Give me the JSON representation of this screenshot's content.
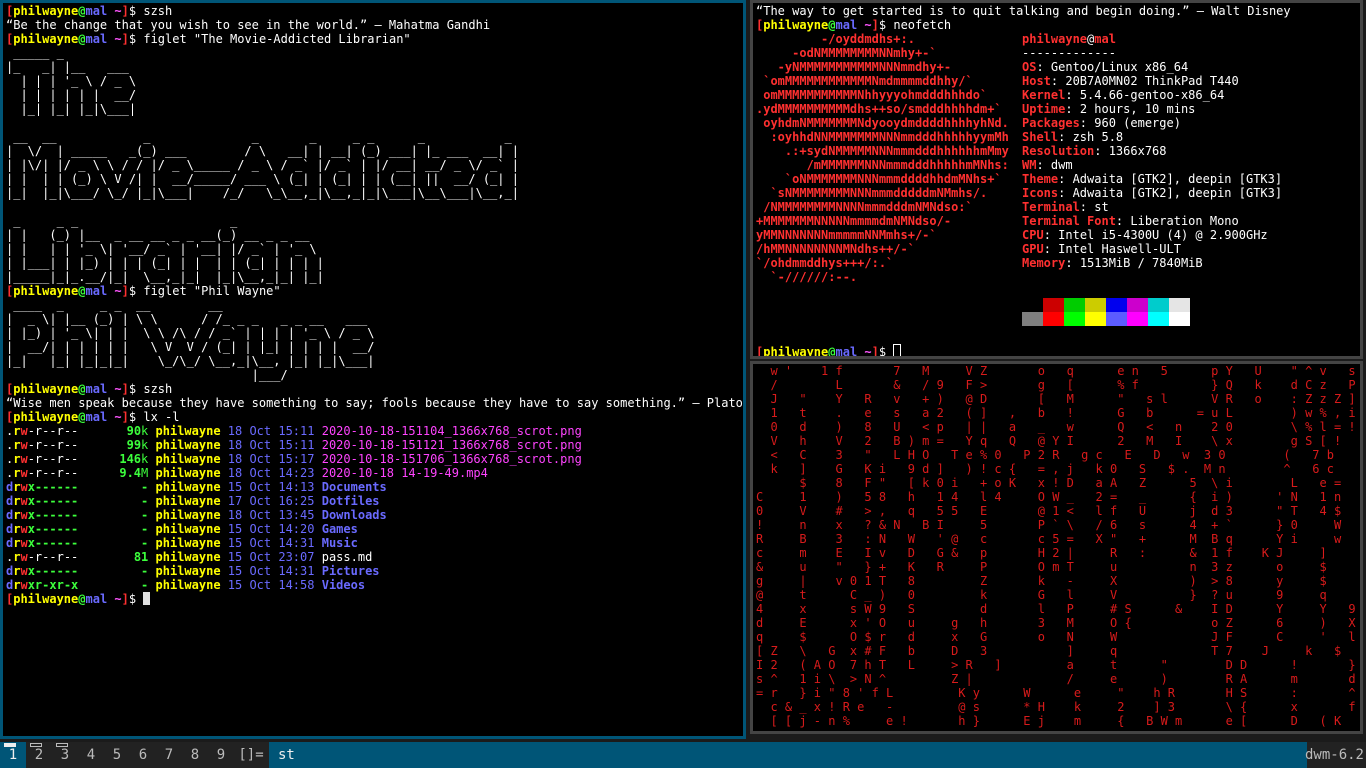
{
  "term1": {
    "prompt": {
      "user": "philwayne",
      "host": "mal",
      "dir": "~"
    },
    "cmd1": "szsh",
    "quote1": "“Be the change that you wish to see in the world.” — Mahatma Gandhi",
    "cmd2": "figlet \"The Movie-Addicted Librarian\"",
    "figlet1": " _____ _\n|_   _| |__   ___\n  | | | '_ \\ / _ \\\n  | | | | | |  __/\n  |_| |_| |_|\\___|\n\n __  __            _              _       _     _ _      _           _\n|  \\/  | _____   _(_) ___        / \\   __| | __| (_) ___| |_ ___  __| |\n| |\\/| |/ _ \\ \\ / / |/ _ \\_____ / _ \\ / _` |/ _` | |/ __| __/ _ \\/ _` |\n| |  | | (_) \\ V /| |  __/_____/ ___ \\ (_| | (_| | | (__| ||  __/ (_| |\n|_|  |_|\\___/ \\_/ |_|\\___|    /_/   \\_\\__,_|\\__,_|_|\\___|\\__\\___|\\__,_|\n\n _     _ _                     _\n| |   (_) |__  _ __ __ _ _ __(_) __ _ _ __\n| |   | | '_ \\| '__/ _` | '__| |/ _` | '_ \\\n| |___| | |_) | | | (_| | |  | | (_| | | | |\n|_____|_|_.__/|_|  \\__,_|_|  |_|\\__,_|_| |_|\n",
    "cmd3": "figlet \"Phil Wayne\"",
    "figlet2": " ____  _     _ _  __        __\n|  _ \\| |__ (_) | \\ \\      / /_ _ _   _ _ __   ___\n| |_) | '_ \\| | |  \\ \\ /\\ / / _` | | | | '_ \\ / _ \\\n|  __/| | | | | |   \\ V  V / (_| | |_| | | | |  __/\n|_|   |_| |_|_|_|    \\_/\\_/ \\__,_|\\__, |_| |_|\\___|\n                                  |___/",
    "cmd4": "szsh",
    "quote2": "“Wise men speak because they have something to say; fools because they have to say something.” — Plato",
    "cmd5": "lx -l",
    "files": [
      {
        "perm_prefix": ".",
        "r": "r",
        "w": "w",
        "rest": "-r--r--",
        "size": "90",
        "unit": "k",
        "owner": "philwayne",
        "date": "18 Oct 15:11",
        "name": "2020-10-18-151104_1366x768_scrot.png",
        "kind": "img"
      },
      {
        "perm_prefix": ".",
        "r": "r",
        "w": "w",
        "rest": "-r--r--",
        "size": "99",
        "unit": "k",
        "owner": "philwayne",
        "date": "18 Oct 15:11",
        "name": "2020-10-18-151121_1366x768_scrot.png",
        "kind": "img"
      },
      {
        "perm_prefix": ".",
        "r": "r",
        "w": "w",
        "rest": "-r--r--",
        "size": "146",
        "unit": "k",
        "owner": "philwayne",
        "date": "18 Oct 15:17",
        "name": "2020-10-18-151706_1366x768_scrot.png",
        "kind": "img"
      },
      {
        "perm_prefix": ".",
        "r": "r",
        "w": "w",
        "rest": "-r--r--",
        "size": "9.4",
        "unit": "M",
        "owner": "philwayne",
        "date": "18 Oct 14:23",
        "name": "2020-10-18 14-19-49.mp4",
        "kind": "img"
      },
      {
        "perm_prefix": "d",
        "r": "r",
        "w": "w",
        "rest": "x------",
        "size": "-",
        "unit": "",
        "owner": "philwayne",
        "date": "15 Oct 14:13",
        "name": "Documents",
        "kind": "dir"
      },
      {
        "perm_prefix": "d",
        "r": "r",
        "w": "w",
        "rest": "x------",
        "size": "-",
        "unit": "",
        "owner": "philwayne",
        "date": "17 Oct 16:25",
        "name": "Dotfiles",
        "kind": "dir"
      },
      {
        "perm_prefix": "d",
        "r": "r",
        "w": "w",
        "rest": "x------",
        "size": "-",
        "unit": "",
        "owner": "philwayne",
        "date": "18 Oct 13:45",
        "name": "Downloads",
        "kind": "dir"
      },
      {
        "perm_prefix": "d",
        "r": "r",
        "w": "w",
        "rest": "x------",
        "size": "-",
        "unit": "",
        "owner": "philwayne",
        "date": "15 Oct 14:20",
        "name": "Games",
        "kind": "dir"
      },
      {
        "perm_prefix": "d",
        "r": "r",
        "w": "w",
        "rest": "x------",
        "size": "-",
        "unit": "",
        "owner": "philwayne",
        "date": "15 Oct 14:31",
        "name": "Music",
        "kind": "dir"
      },
      {
        "perm_prefix": ".",
        "r": "r",
        "w": "w",
        "rest": "-r--r--",
        "size": "81",
        "unit": "",
        "owner": "philwayne",
        "date": "15 Oct 23:07",
        "name": "pass.md",
        "kind": "file"
      },
      {
        "perm_prefix": "d",
        "r": "r",
        "w": "w",
        "rest": "x------",
        "size": "-",
        "unit": "",
        "owner": "philwayne",
        "date": "15 Oct 14:31",
        "name": "Pictures",
        "kind": "dir"
      },
      {
        "perm_prefix": "d",
        "r": "r",
        "w": "w",
        "rest": "xr-xr-x",
        "size": "-",
        "unit": "",
        "owner": "philwayne",
        "date": "15 Oct 14:58",
        "name": "Videos",
        "kind": "dir"
      }
    ]
  },
  "term2": {
    "quote": "“The way to get started is to quit talking and begin doing.” — Walt Disney",
    "cmd": "neofetch",
    "logo": "         -/oyddmdhs+:.\n     -odNMMMMMMMMNNmhy+-`\n   -yNMMMMMMMMMMMNNNmmdhy+-\n `omMMMMMMMMMMMMNmdmmmmddhhy/`\n omMMMMMMMMMMMNhhyyyohmdddhhhdo`\n.ydMMMMMMMMMMdhs++so/smdddhhhhdm+`\n oyhdmNMMMMMMMNdyooydmddddhhhhyhNd.\n  :oyhhdNNMMMMMMMNNNmmdddhhhhhyymMh\n    .:+sydNMMMMMNNNmmmdddhhhhhhmMmy\n       /mMMMMMMNNNmmmdddhhhhhmMNhs:\n    `oNMMMMMMMNNNmmmddddhhdmMNhs+`\n  `sNMMMMMMMMNNNmmmdddddmNMmhs/.\n /NMMMMMMMMNNNNmmmdddmNMNdso:`\n+MMMMMMMNNNNNmmmmdmNMNdso/-\nyMMNNNNNNNmmmmmNNMmhs+/-`\n/hMMNNNNNNNNMNdhs++/-`\n`/ohdmmddhys+++/:.`\n  `-//////:--.",
    "user": "philwayne",
    "host": "mal",
    "sep": "-------------",
    "info": [
      {
        "k": "OS",
        "v": "Gentoo/Linux x86_64"
      },
      {
        "k": "Host",
        "v": "20B7A0MN02 ThinkPad T440"
      },
      {
        "k": "Kernel",
        "v": "5.4.66-gentoo-x86_64"
      },
      {
        "k": "Uptime",
        "v": "2 hours, 10 mins"
      },
      {
        "k": "Packages",
        "v": "960 (emerge)"
      },
      {
        "k": "Shell",
        "v": "zsh 5.8"
      },
      {
        "k": "Resolution",
        "v": "1366x768"
      },
      {
        "k": "WM",
        "v": "dwm"
      },
      {
        "k": "Theme",
        "v": "Adwaita [GTK2], deepin [GTK3]"
      },
      {
        "k": "Icons",
        "v": "Adwaita [GTK2], deepin [GTK3]"
      },
      {
        "k": "Terminal",
        "v": "st"
      },
      {
        "k": "Terminal Font",
        "v": "Liberation Mono"
      },
      {
        "k": "CPU",
        "v": "Intel i5-4300U (4) @ 2.900GHz"
      },
      {
        "k": "GPU",
        "v": "Intel Haswell-ULT"
      },
      {
        "k": "Memory",
        "v": "1513MiB / 7840MiB"
      }
    ],
    "palette_top": [
      "#000000",
      "#cc0000",
      "#00cc00",
      "#cccc00",
      "#0000ee",
      "#cc00cc",
      "#00cccc",
      "#e5e5e5"
    ],
    "palette_bottom": [
      "#7f7f7f",
      "#ff0000",
      "#00ff00",
      "#ffff00",
      "#5c5cff",
      "#ff00ff",
      "#00ffff",
      "#ffffff"
    ]
  },
  "term3": {
    "rain": "  w '    1 f       7   M     V Z       o   q      e n   5      p Y   U    \" ^ v   s M ]\n  /        L       &   / 9   F >       g   [      % f          } Q   k    d C z   P ` ]\n  J   \"    Y   R   v   + )   @ D       [   M      \"   s l      V R   o    : Z z Z ] | Y\n  1   t    .   e   s   a 2   ( ]   ,   b   !      G   b      = u L        ) w % , i   &\n  0   d    )   8   U   < p   | |   a   _   w      Q   <   n    2 0        \\ % l = !   W\n  V   h    V   2   B ) m =   Y q   Q   @ Y I      2   M   I    \\ x        g S [ !     C\n  <   C    3   \"   L H O   T e % 0   P 2 R   g c   E   D   w  3 0        (   7 b     N\n  k   ]    G   K i   9 d ]   ) ! c {   = , j   k 0   S   $ .  M n        ^   6 c     {\n      $    8   F \"   [ k 0 i   + o K   x ! D   a A   Z      5  \\ i        L   e =     =\nC     1    )   5 8   h   1 4   l 4     O W _   2 =   _      {  i )      ' N   1 n     X\n0     V    #   > ,   q   5 5   E       @ 1 <   l f   U      j  d 3      \" T   4 $     <\n!     n    x   ? & N   B I     5       P ` \\   / 6   s      4  + `      } 0     W     w\nR     B    3   : N   W   ' @   c       c 5 =   X \"   +      M  B q      Y i     w     o\nc     m    E   I v   D   G &   p       H 2 |     R   :      &  1 f    K J     ]     -\n&     u    \"   } +   K   R     P       O m T     u          n  3 z      o     $     M\ng     |    v 0 1 T   8         Z       k   -     X          )  > 8      y     $     D\n@     t      C _ )   0         k       G   l     V          }  ? u      9     q     #\n4     x      s W 9   S         d       l   P     # S      &    I D      Y     Y   9\nd     E      x ' O   u     g   h       3   M     O {           o Z      6     )   X\nq     $      O $ r   d     x   G       o   N     W             J F      C     '   l\n[ Z   \\   G  x # F   b     D   3           ]     q             T 7    J     k   $\nI 2   ( A O  7 h T   L     > R   ]         a     t      \"        D D      !       }\ns ^   1 i \\  > N ^         Z |             /     e      )        R A      m       d\n= r   } i \" 8 ' f L         K y      W      e     \"    h R       H S      :       ^\n  c & _ x ! R e   -         @ s      * H    k     2    ] 3       \\ {      x       f\n  [ [ j - n %     e !       h }      E j    m     {   B W m      e [      D   ( K"
  },
  "bar": {
    "tags": [
      "1",
      "2",
      "3",
      "4",
      "5",
      "6",
      "7",
      "8",
      "9"
    ],
    "layout": "[]=",
    "title": "st",
    "status": "dwm-6.2"
  }
}
